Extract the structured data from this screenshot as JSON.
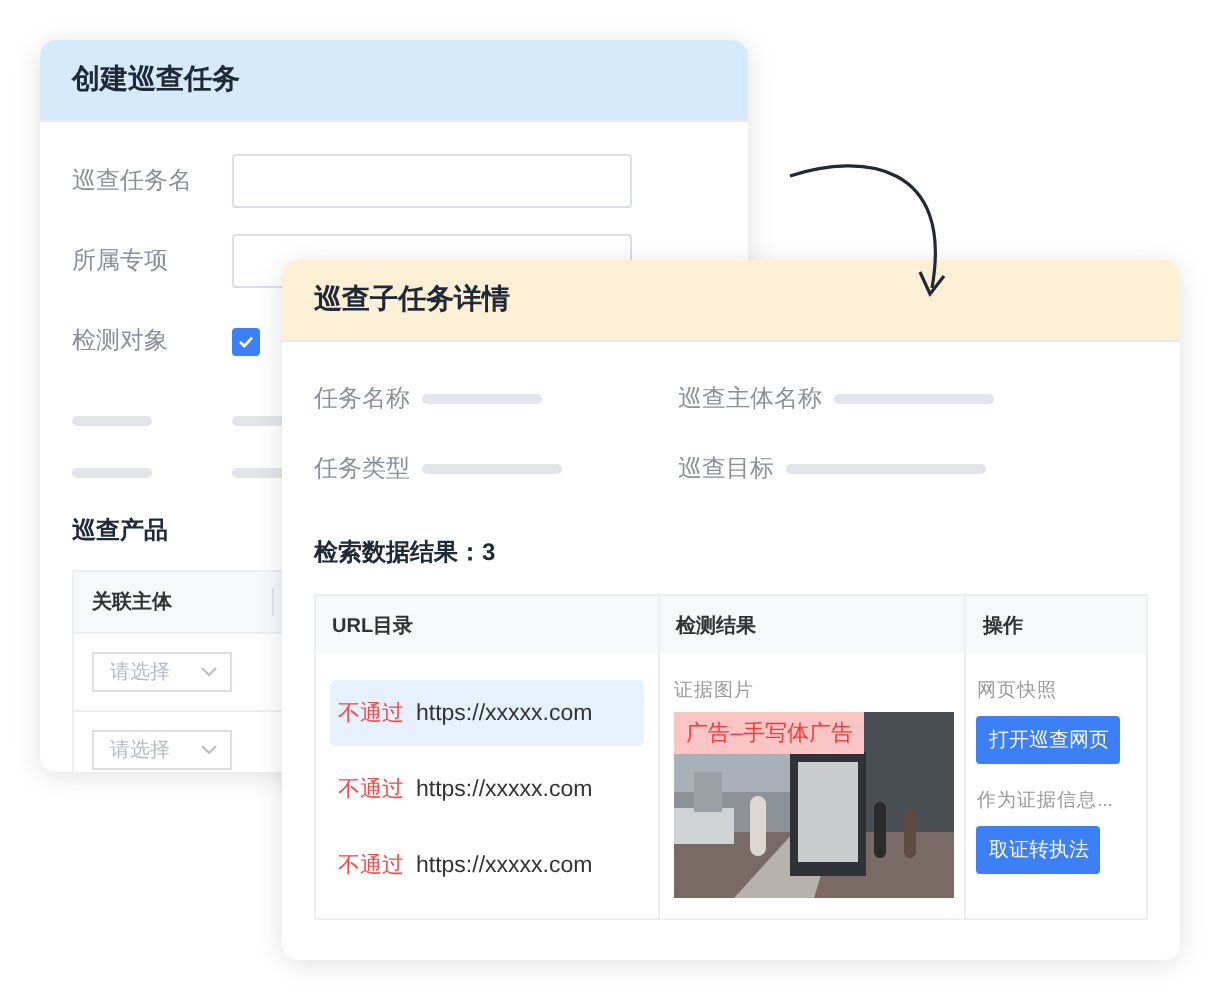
{
  "create_task": {
    "title": "创建巡查任务",
    "fields": [
      {
        "label": "巡查任务名",
        "kind": "input"
      },
      {
        "label": "所属专项",
        "kind": "input"
      },
      {
        "label": "检测对象",
        "kind": "checkbox",
        "checked": true
      }
    ],
    "section_title": "巡查产品",
    "table": {
      "columns": [
        "关联主体"
      ],
      "rows": [
        {
          "placeholder": "请选择"
        },
        {
          "placeholder": "请选择"
        }
      ]
    }
  },
  "subtask_detail": {
    "title": "巡查子任务详情",
    "info": [
      {
        "label": "任务名称"
      },
      {
        "label": "巡查主体名称"
      },
      {
        "label": "任务类型"
      },
      {
        "label": "巡查目标"
      }
    ],
    "result_label": "检索数据结果：",
    "result_count": "3",
    "table": {
      "columns": [
        "URL目录",
        "检测结果",
        "操作"
      ],
      "urls": [
        {
          "status": "不通过",
          "url": "https://xxxxx.com",
          "selected": true
        },
        {
          "status": "不通过",
          "url": "https://xxxxx.com",
          "selected": false
        },
        {
          "status": "不通过",
          "url": "https://xxxxx.com",
          "selected": false
        }
      ],
      "evidence": {
        "label": "证据图片",
        "tag": "广告–手写体广告"
      },
      "actions": [
        {
          "kind": "caption",
          "text": "网页快照"
        },
        {
          "kind": "button",
          "text": "打开巡查网页"
        },
        {
          "kind": "caption",
          "text": "作为证据信息..."
        },
        {
          "kind": "button",
          "text": "取证转执法"
        }
      ]
    }
  }
}
